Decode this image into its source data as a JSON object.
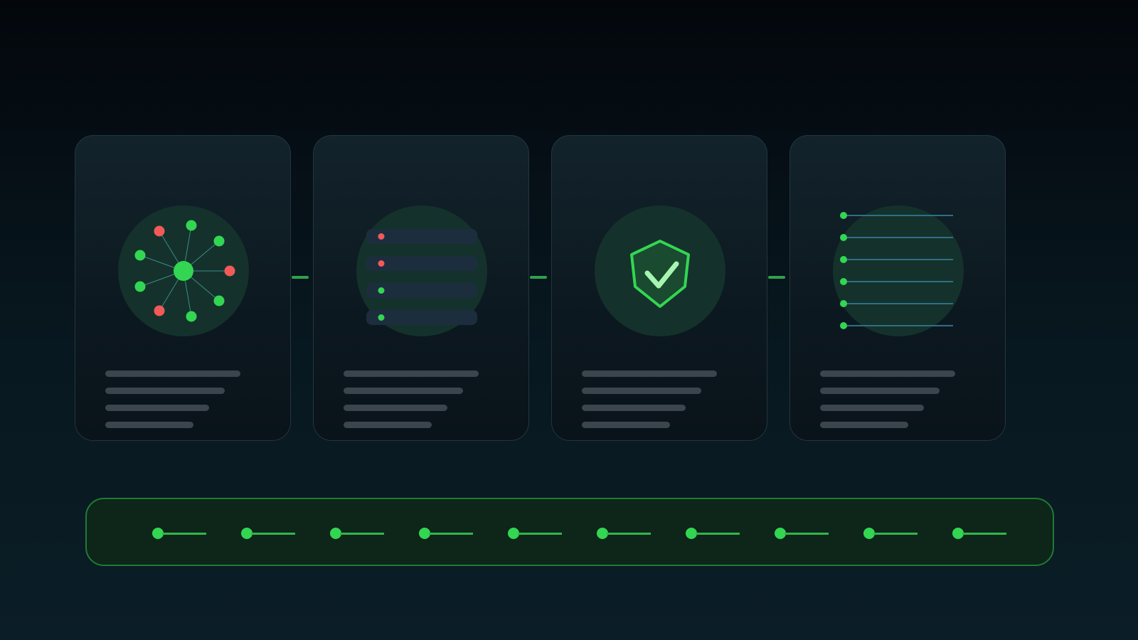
{
  "diagram": {
    "cards": [
      {
        "id": "network",
        "icon": "network-node-icon",
        "text_lines": 4
      },
      {
        "id": "list",
        "icon": "status-list-icon",
        "text_lines": 4
      },
      {
        "id": "shield",
        "icon": "shield-check-icon",
        "text_lines": 4
      },
      {
        "id": "timeline",
        "icon": "timeline-list-icon",
        "text_lines": 4
      }
    ],
    "footer_steps": 10,
    "colors": {
      "accent_green": "#33d652",
      "alert_red": "#f25a5a",
      "card_border": "#24353f",
      "placeholder_line": "#3a454d",
      "footer_border": "#1f7a35",
      "footer_fill": "#0e2519"
    }
  }
}
